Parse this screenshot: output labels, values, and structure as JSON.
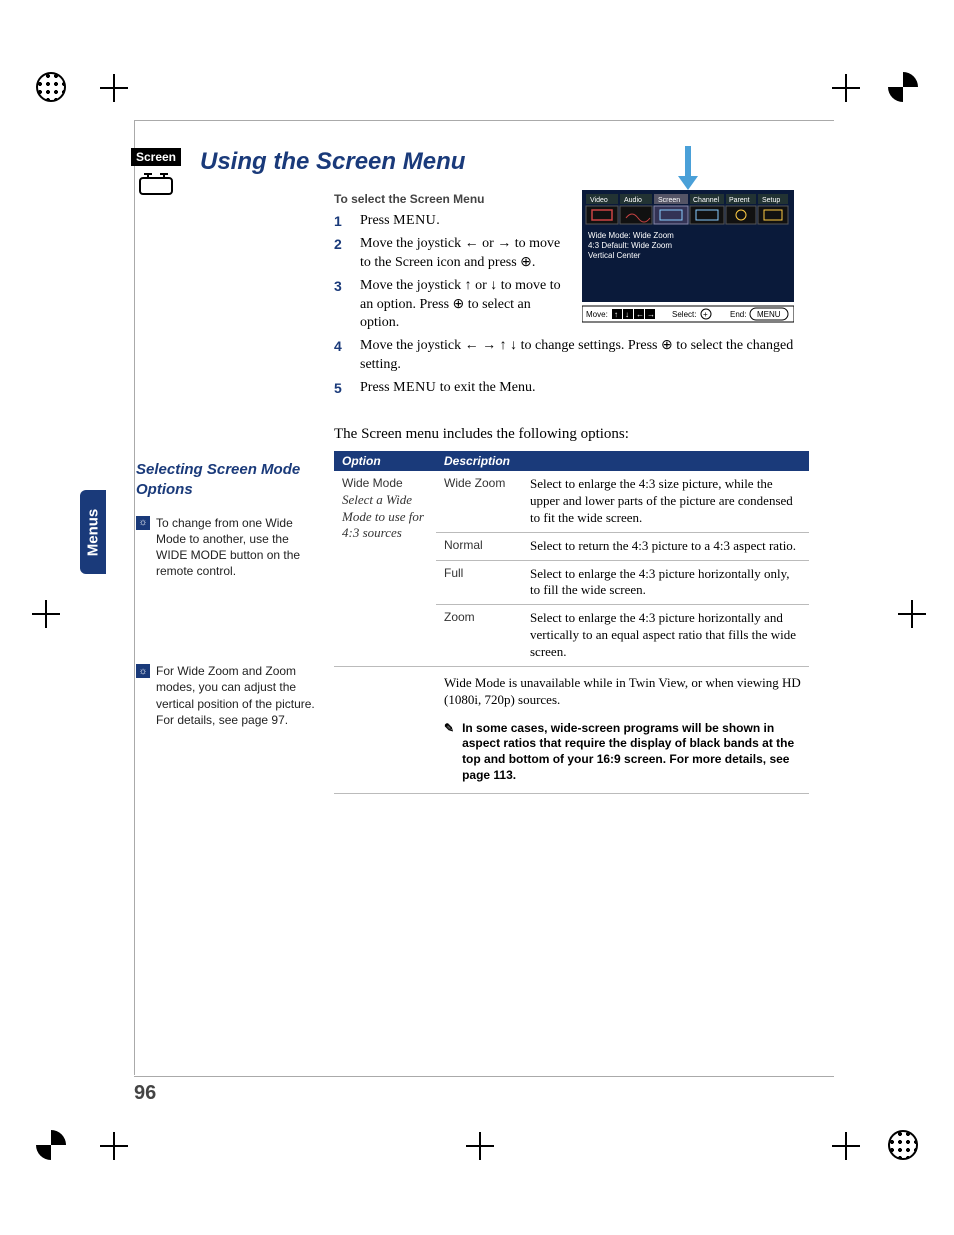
{
  "page_number": "96",
  "side_tab": "Menus",
  "screen_badge": "Screen",
  "title": "Using the Screen Menu",
  "section_subhead": "To select the Screen Menu",
  "steps": [
    {
      "num": "1",
      "text_pre": "Press ",
      "smallcap": "MENU",
      "text_post": "."
    },
    {
      "num": "2",
      "text": "Move the joystick ← or → to move to the Screen icon and press ⊕."
    },
    {
      "num": "3",
      "text": "Move the joystick ↑ or ↓ to move to an option. Press ⊕ to select an option."
    },
    {
      "num": "4",
      "text": "Move the joystick ← → ↑ ↓ to change settings. Press ⊕ to select the changed setting."
    },
    {
      "num": "5",
      "text_pre": "Press ",
      "smallcap": "MENU",
      "text_post": " to exit the Menu."
    }
  ],
  "tv_menu": {
    "tabs": [
      "Video",
      "Audio",
      "Screen",
      "Channel",
      "Parent",
      "Setup"
    ],
    "lines": [
      "Wide Mode: Wide Zoom",
      "4:3 Default: Wide Zoom",
      "Vertical Center"
    ],
    "footer": {
      "move": "Move:",
      "select": "Select:",
      "end": "End:",
      "end_val": "MENU"
    }
  },
  "sidebar": {
    "heading": "Selecting Screen Mode Options",
    "tip1": "To change from one Wide Mode to another, use the WIDE MODE button on the remote control.",
    "tip2": "For Wide Zoom and Zoom modes, you can adjust the vertical position of the picture. For details, see page 97."
  },
  "intro": "The Screen menu includes the following options:",
  "table": {
    "headers": [
      "Option",
      "Description"
    ],
    "group_option": "Wide Mode",
    "group_option_sub": "Select a Wide Mode to use for 4:3 sources",
    "rows": [
      {
        "name": "Wide Zoom",
        "desc": "Select to enlarge the 4:3 size picture, while the upper and lower parts of the picture are condensed to fit the wide screen."
      },
      {
        "name": "Normal",
        "desc": "Select to return the 4:3 picture to a 4:3 aspect ratio."
      },
      {
        "name": "Full",
        "desc": "Select to enlarge the 4:3 picture horizontally only, to fill the wide screen."
      },
      {
        "name": "Zoom",
        "desc": "Select to enlarge the 4:3 picture horizontally and vertically to an equal aspect ratio that fills the wide screen."
      }
    ],
    "note1": "Wide Mode is unavailable while in Twin View, or when viewing HD (1080i, 720p) sources.",
    "note2": "In some cases, wide-screen programs will be shown in aspect ratios that require the display of black bands at the top and bottom of your 16:9 screen. For more details, see page 113."
  }
}
